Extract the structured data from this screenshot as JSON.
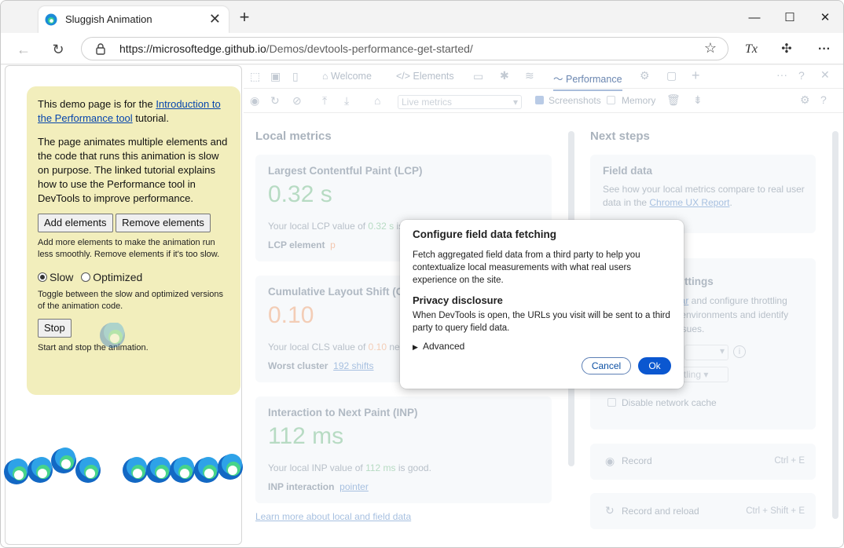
{
  "browser": {
    "tab_title": "Sluggish Animation",
    "url_domain": "https://microsoftedge.github.io",
    "url_path": "/Demos/devtools-performance-get-started/"
  },
  "demo": {
    "intro_prefix": "This demo page is for the ",
    "intro_link": "Introduction to the Performance tool",
    "intro_suffix": " tutorial.",
    "description": "The page animates multiple elements and the code that runs this animation is slow on purpose. The linked tutorial explains how to use the Performance tool in DevTools to improve performance.",
    "add_button": "Add elements",
    "remove_button": "Remove elements",
    "add_help": "Add more elements to make the animation run less smoothly. Remove elements if it's too slow.",
    "radio_slow": "Slow",
    "radio_optimized": "Optimized",
    "toggle_help": "Toggle between the slow and optimized versions of the animation code.",
    "stop_button": "Stop",
    "stop_help": "Start and stop the animation."
  },
  "devtools": {
    "tabs": [
      "Welcome",
      "Elements",
      "Performance"
    ],
    "active_tab": "Performance",
    "throttle_select": "Live metrics",
    "screenshots_label": "Screenshots",
    "memory_label": "Memory",
    "local_metrics_title": "Local metrics",
    "next_steps_title": "Next steps",
    "lcp": {
      "title": "Largest Contentful Paint (LCP)",
      "value": "0.32 s",
      "text_prefix": "Your local LCP value of ",
      "text_value": "0.32 s",
      "text_suffix": " is",
      "element_label": "LCP element",
      "element_value": "p"
    },
    "cls": {
      "title": "Cumulative Layout Shift (C",
      "value": "0.10",
      "text_prefix": "Your local CLS value of ",
      "text_value": "0.10",
      "text_suffix": " nee",
      "worst_label": "Worst cluster",
      "worst_value": "192 shifts"
    },
    "inp": {
      "title": "Interaction to Next Paint (INP)",
      "value": "112 ms",
      "text_prefix": "Your local INP value of ",
      "text_value": "112 ms",
      "text_suffix": " is good.",
      "interaction_label": "INP interaction",
      "interaction_value": "pointer"
    },
    "learn_more": "Learn more about local and field data",
    "field_data": {
      "title": "Field data",
      "text": "See how your local metrics compare to real user data in the ",
      "link": "Chrome UX Report",
      "link_suffix": "."
    },
    "settings": {
      "title_partial": "ttings",
      "line1_link": "bar",
      "line1": " and configure throttling",
      "line2": "r environments and identify",
      "line3": "issues.",
      "throttle_partial": "tling",
      "disable_cache": "Disable network cache"
    },
    "record": {
      "label": "Record",
      "shortcut": "Ctrl + E"
    },
    "record_reload": {
      "label": "Record and reload",
      "shortcut": "Ctrl + Shift + E"
    }
  },
  "dialog": {
    "title": "Configure field data fetching",
    "body": "Fetch aggregated field data from a third party to help you contextualize local measurements with what real users experience on the site.",
    "privacy_title": "Privacy disclosure",
    "privacy_body": "When DevTools is open, the URLs you visit will be sent to a third party to query field data.",
    "advanced": "Advanced",
    "cancel": "Cancel",
    "ok": "Ok"
  },
  "colors": {
    "lcp_green": "#b7dbc3",
    "cls_orange": "#f3cdb6",
    "accent_blue": "#0b57d0"
  }
}
